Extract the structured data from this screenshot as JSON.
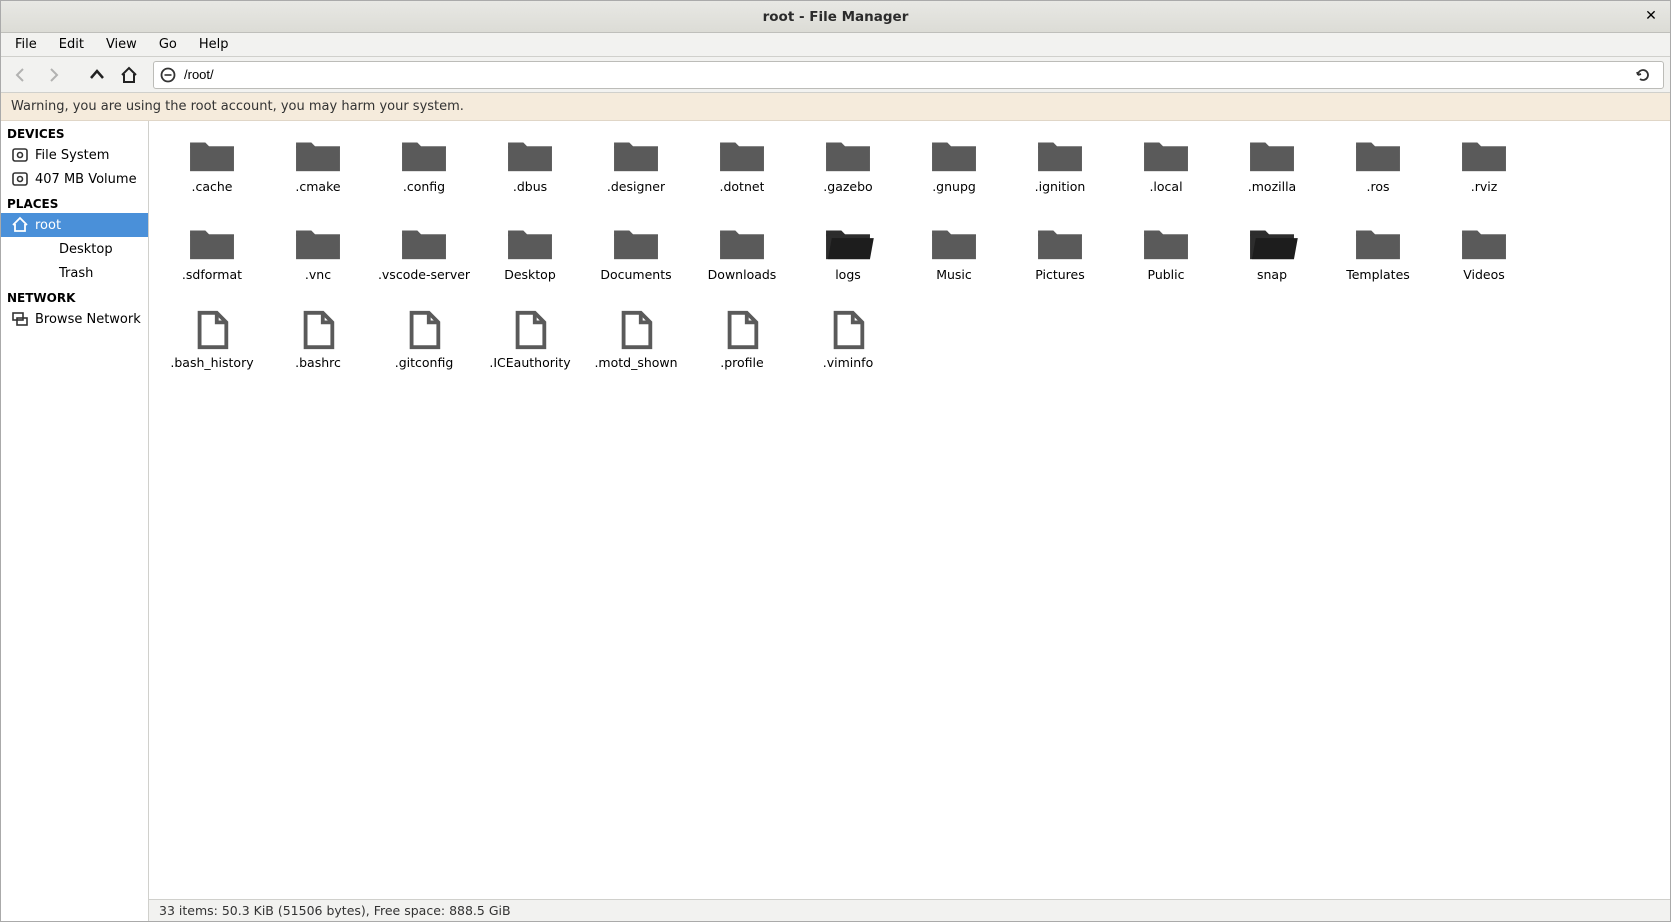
{
  "window": {
    "title": "root - File Manager"
  },
  "menubar": [
    "File",
    "Edit",
    "View",
    "Go",
    "Help"
  ],
  "path": "/root/",
  "warning": "Warning, you are using the root account, you may harm your system.",
  "sidebar": {
    "devices_header": "DEVICES",
    "devices": [
      {
        "label": "File System",
        "icon": "disk"
      },
      {
        "label": "407 MB Volume",
        "icon": "disk"
      }
    ],
    "places_header": "PLACES",
    "places": [
      {
        "label": "root",
        "icon": "home",
        "selected": true
      },
      {
        "label": "Desktop",
        "icon": "none",
        "indent": true
      },
      {
        "label": "Trash",
        "icon": "none",
        "indent": true
      }
    ],
    "network_header": "NETWORK",
    "network": [
      {
        "label": "Browse Network",
        "icon": "network"
      }
    ]
  },
  "items": [
    {
      "name": ".cache",
      "type": "folder"
    },
    {
      "name": ".cmake",
      "type": "folder"
    },
    {
      "name": ".config",
      "type": "folder"
    },
    {
      "name": ".dbus",
      "type": "folder"
    },
    {
      "name": ".designer",
      "type": "folder"
    },
    {
      "name": ".dotnet",
      "type": "folder"
    },
    {
      "name": ".gazebo",
      "type": "folder"
    },
    {
      "name": ".gnupg",
      "type": "folder"
    },
    {
      "name": ".ignition",
      "type": "folder"
    },
    {
      "name": ".local",
      "type": "folder"
    },
    {
      "name": ".mozilla",
      "type": "folder"
    },
    {
      "name": ".ros",
      "type": "folder"
    },
    {
      "name": ".rviz",
      "type": "folder"
    },
    {
      "name": ".sdformat",
      "type": "folder"
    },
    {
      "name": ".vnc",
      "type": "folder"
    },
    {
      "name": ".vscode-server",
      "type": "folder"
    },
    {
      "name": "Desktop",
      "type": "folder-nolid"
    },
    {
      "name": "Documents",
      "type": "folder-nolid"
    },
    {
      "name": "Downloads",
      "type": "folder-nolid"
    },
    {
      "name": "logs",
      "type": "folder-open"
    },
    {
      "name": "Music",
      "type": "folder-nolid"
    },
    {
      "name": "Pictures",
      "type": "folder-nolid"
    },
    {
      "name": "Public",
      "type": "folder-nolid"
    },
    {
      "name": "snap",
      "type": "folder-open"
    },
    {
      "name": "Templates",
      "type": "folder-nolid"
    },
    {
      "name": "Videos",
      "type": "folder-nolid"
    },
    {
      "name": ".bash_history",
      "type": "file"
    },
    {
      "name": ".bashrc",
      "type": "file"
    },
    {
      "name": ".gitconfig",
      "type": "file"
    },
    {
      "name": ".ICEauthority",
      "type": "file"
    },
    {
      "name": ".motd_shown",
      "type": "file"
    },
    {
      "name": ".profile",
      "type": "file"
    },
    {
      "name": ".viminfo",
      "type": "file"
    }
  ],
  "status": "33 items: 50.3 KiB (51506 bytes), Free space: 888.5 GiB"
}
